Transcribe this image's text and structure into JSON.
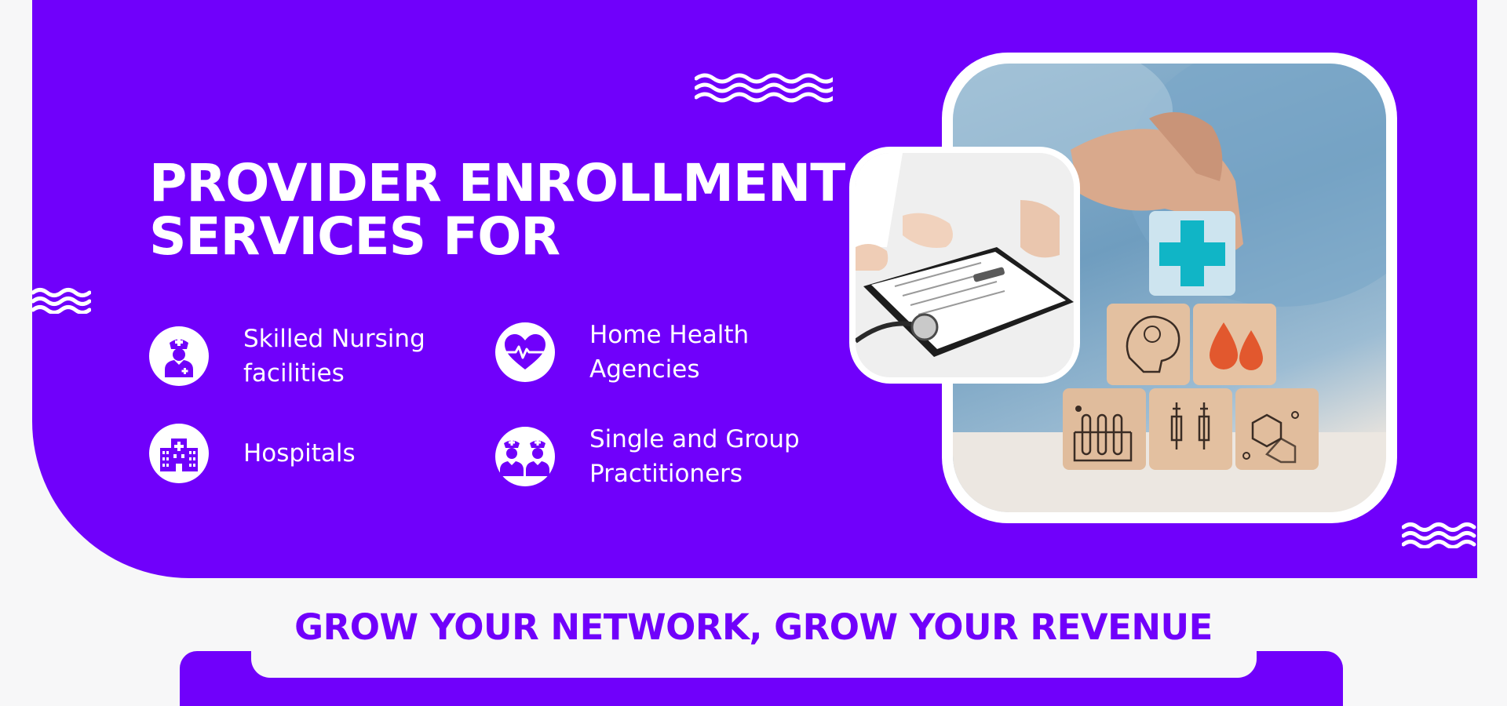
{
  "hero": {
    "title_line1": "PROVIDER ENROLLMENT",
    "title_line2": "SERVICES FOR",
    "features": [
      {
        "line1": "Skilled Nursing",
        "line2": "facilities",
        "icon": "nurse-icon"
      },
      {
        "line1": "Home Health",
        "line2": "Agencies",
        "icon": "heart-pulse-icon"
      },
      {
        "line1": "Hospitals",
        "line2": "",
        "icon": "hospital-icon"
      },
      {
        "line1": "Single and Group",
        "line2": "Practitioners",
        "icon": "practitioners-icon"
      }
    ]
  },
  "tagline": "GROW YOUR NETWORK, GROW YOUR REVENUE",
  "colors": {
    "accent": "#7000fb",
    "background": "#f7f7f8",
    "text_light": "#ffffff"
  }
}
